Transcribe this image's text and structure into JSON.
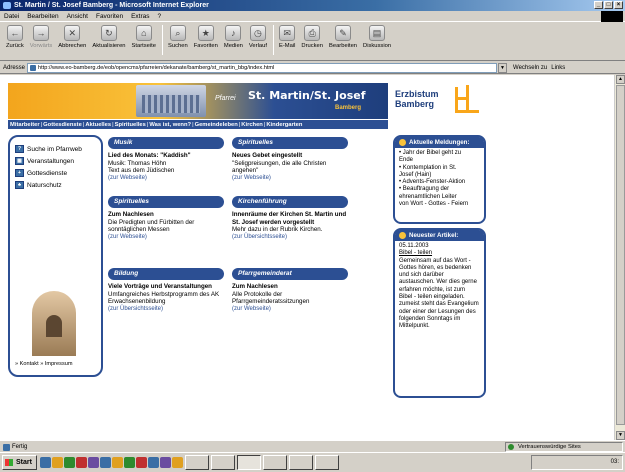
{
  "window": {
    "title": "St. Martin / St. Josef Bamberg - Microsoft Internet Explorer"
  },
  "menu": [
    "Datei",
    "Bearbeiten",
    "Ansicht",
    "Favoriten",
    "Extras",
    "?"
  ],
  "toolbar": {
    "buttons": [
      "Zurück",
      "Vorwärts",
      "Abbrechen",
      "Aktualisieren",
      "Startseite",
      "Suchen",
      "Favoriten",
      "Medien",
      "Verlauf",
      "E-Mail",
      "Drucken",
      "Bearbeiten",
      "Diskussion"
    ]
  },
  "address": {
    "label": "Adresse",
    "url": "http://www.eo-bamberg.de/eob/opencms/pfarreien/dekanate/bamberg/st_martin_bbg/index.html",
    "go": "Wechseln zu",
    "links": "Links"
  },
  "banner": {
    "pfarrei": "Pfarrei",
    "parish": "St. Martin/St. Josef",
    "city": "Bamberg"
  },
  "logo": {
    "line1": "Erzbistum",
    "line2": "Bamberg"
  },
  "nav": [
    "Mitarbeiter",
    "Gottesdienste",
    "Aktuelles",
    "Spirituelles",
    "Was ist, wenn?",
    "Gemeindeleben",
    "Kirchen",
    "Kindergarten"
  ],
  "sidebar": {
    "items": [
      "Suche im Pfarrweb",
      "Veranstaltungen",
      "Gottesdienste",
      "Naturschutz"
    ],
    "footer": "» Kontakt » Impressum"
  },
  "boxes": {
    "musik": {
      "head": "Musik",
      "title": "Lied des Monats: \"Kaddish\"",
      "body": "Musik: Thomas Höhn\nText aus dem Jüdischen",
      "more": "(zur Webseite)"
    },
    "spirit1": {
      "head": "Spirituelles",
      "title": "Neues Gebet eingestellt",
      "body": "\"Seligpreisungen, die alle Christen angehen\"",
      "more": "(zur Webseite)"
    },
    "spirit2": {
      "head": "Spirituelles",
      "title": "Zum Nachlesen",
      "body": "Die Predigten und Fürbitten der sonntäglichen Messen",
      "more": "(zur Webseite)"
    },
    "kirchen": {
      "head": "Kirchenführung",
      "title": "Innenräume der Kirchen St. Martin und St. Josef werden vorgestellt",
      "body": "Mehr dazu in der Rubrik Kirchen.",
      "more": "(zur Übersichtsseite)"
    },
    "bildung": {
      "head": "Bildung",
      "title": "Viele Vorträge und Veranstaltungen",
      "body": "Umfangreiches Herbstprogramm des AK Erwachsenenbildung",
      "more": "(zur Übersichtsseite)"
    },
    "pgr": {
      "head": "Pfarrgemeinderat",
      "title": "Zum Nachlesen",
      "body": "Alle Protokolle der Pfarrgemeinderatssitzungen",
      "more": "(zur Webseite)"
    }
  },
  "news": {
    "head": "Aktuelle Meldungen:",
    "items": [
      "• Jahr der Bibel geht zu",
      "  Ende",
      "• Kontemplation in St.",
      "  Josef (Hain)",
      "• Advents-Fenster-Aktion",
      "• Beauftragung der",
      "  ehrenamtlichen Leiter",
      "  von Wort - Gottes - Feiern"
    ]
  },
  "article": {
    "head": "Neuester Artikel:",
    "date": "05.11.2003",
    "title": "Bibel - teilen",
    "text": "Gemeinsam auf das Wort - Gottes hören, es bedenken und sich darüber austauschen. Wer dies gerne erfahren möchte, ist zum Bibel - teilen eingeladen. zumeist steht das Evangelium oder einer der Lesungen des folgenden Sonntags im Mittelpunkt."
  },
  "status": {
    "text": "Fertig",
    "zone": "Vertrauenswürdige Sites"
  },
  "taskbar": {
    "start": "Start",
    "clock": "03:"
  }
}
